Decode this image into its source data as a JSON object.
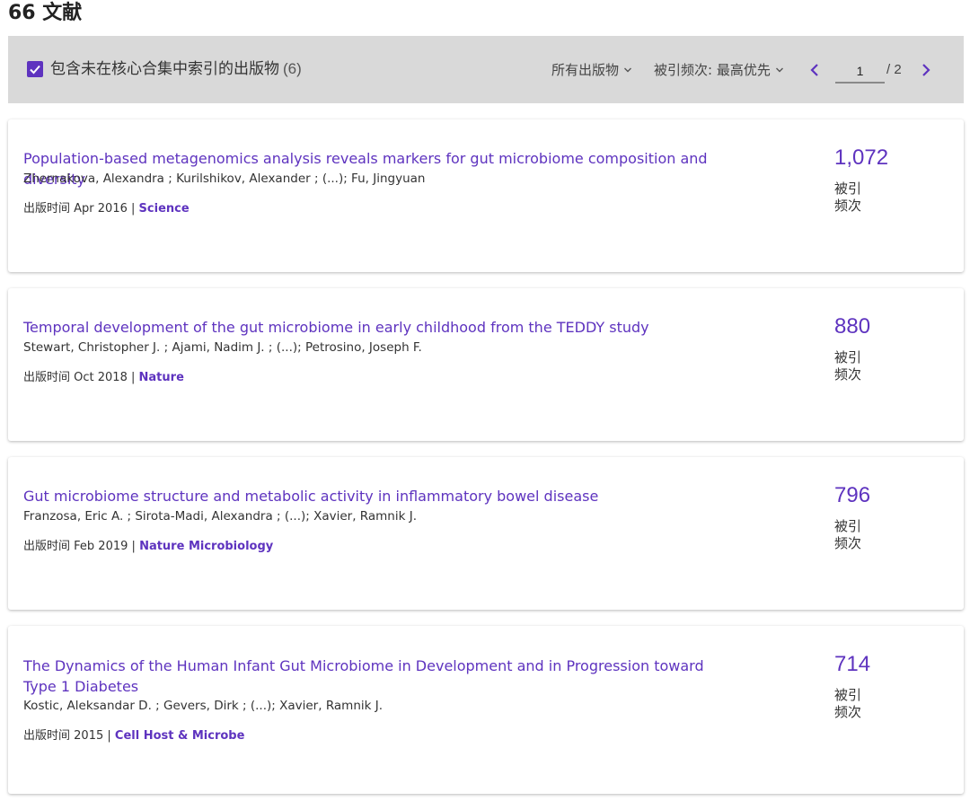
{
  "header": {
    "title": "66 文献"
  },
  "toolbar": {
    "include_label": "包含未在核心合集中索引的出版物",
    "include_count": "(6)",
    "publications_filter": "所有出版物",
    "sort_label": "被引频次: 最高优先",
    "page_current": "1",
    "page_total": "/ 2"
  },
  "colors": {
    "accent": "#5e33bf",
    "toolbar_bg": "#d9d9d9"
  },
  "icons": {
    "checkbox": "checkmark-icon",
    "prev": "chevron-left-icon",
    "next": "chevron-right-icon",
    "dropdown": "chevron-down-icon"
  },
  "results": [
    {
      "title": "Population-based metagenomics analysis reveals markers for gut microbiome composition and diversity",
      "authors": "Zhernakova, Alexandra ; Kurilshikov, Alexander ; (...); Fu, Jingyuan",
      "date_prefix": "出版时间",
      "date": "Apr 2016",
      "separator": "|",
      "journal": "Science",
      "citations": "1,072",
      "citations_label_1": "被引",
      "citations_label_2": "频次"
    },
    {
      "title": "Temporal development of the gut microbiome in early childhood from the TEDDY study",
      "authors": "Stewart, Christopher J. ; Ajami, Nadim J. ; (...); Petrosino, Joseph F.",
      "date_prefix": "出版时间",
      "date": "Oct 2018",
      "separator": "|",
      "journal": "Nature",
      "citations": "880",
      "citations_label_1": "被引",
      "citations_label_2": "频次"
    },
    {
      "title": "Gut microbiome structure and metabolic activity in inflammatory bowel disease",
      "authors": "Franzosa, Eric A. ; Sirota-Madi, Alexandra ; (...); Xavier, Ramnik J.",
      "date_prefix": "出版时间",
      "date": "Feb 2019",
      "separator": "|",
      "journal": "Nature Microbiology",
      "citations": "796",
      "citations_label_1": "被引",
      "citations_label_2": "频次"
    },
    {
      "title": "The Dynamics of the Human Infant Gut Microbiome in Development and in Progression toward Type 1 Diabetes",
      "authors": "Kostic, Aleksandar D. ; Gevers, Dirk ; (...); Xavier, Ramnik J.",
      "date_prefix": "出版时间",
      "date": "2015",
      "separator": "|",
      "journal": "Cell Host & Microbe",
      "citations": "714",
      "citations_label_1": "被引",
      "citations_label_2": "频次"
    }
  ]
}
